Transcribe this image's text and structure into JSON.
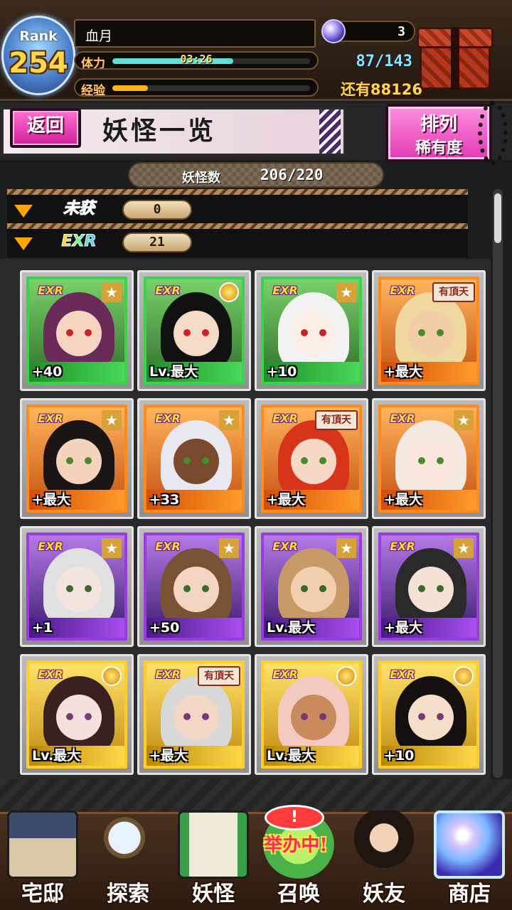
{
  "player": {
    "rank_label": "Rank",
    "rank_value": "254",
    "name": "血月",
    "stamina_label": "体力",
    "stamina_timer": "03:26",
    "stamina_fill": 0.61,
    "stamina_text": "87/143",
    "exp_label": "经验",
    "exp_fill": 0.18,
    "next_text": "还有88126",
    "gems": "3"
  },
  "header": {
    "back_label": "返回",
    "title": "妖怪一览",
    "sort_line1": "排列",
    "sort_line2": "稀有度"
  },
  "count": {
    "label": "妖怪数",
    "value": "206/220"
  },
  "filters": [
    {
      "tag": "未获",
      "value": "0"
    },
    {
      "tag": "EXR",
      "value": "21"
    }
  ],
  "cards": [
    {
      "frame": "green",
      "badge": "EXR",
      "corner": "star",
      "level": "+40"
    },
    {
      "frame": "green",
      "badge": "EXR",
      "corner": "medal",
      "level": "Lv.最大"
    },
    {
      "frame": "green",
      "badge": "EXR",
      "corner": "star",
      "level": "+10"
    },
    {
      "frame": "orange",
      "badge": "EXR",
      "corner": "top",
      "level": "+最大"
    },
    {
      "frame": "orange",
      "badge": "EXR",
      "corner": "star",
      "level": "+最大"
    },
    {
      "frame": "orange",
      "badge": "EXR",
      "corner": "star",
      "level": "+33"
    },
    {
      "frame": "orange",
      "badge": "EXR",
      "corner": "top",
      "level": "+最大"
    },
    {
      "frame": "orange",
      "badge": "EXR",
      "corner": "star",
      "level": "+最大"
    },
    {
      "frame": "purple",
      "badge": "EXR",
      "corner": "star",
      "level": "+1"
    },
    {
      "frame": "purple",
      "badge": "EXR",
      "corner": "star",
      "level": "+50"
    },
    {
      "frame": "purple",
      "badge": "EXR",
      "corner": "star",
      "level": "Lv.最大"
    },
    {
      "frame": "purple",
      "badge": "EXR",
      "corner": "star",
      "level": "+最大"
    },
    {
      "frame": "gold",
      "badge": "EXR",
      "corner": "medal",
      "level": "Lv.最大"
    },
    {
      "frame": "gold",
      "badge": "EXR",
      "corner": "top",
      "level": "+最大"
    },
    {
      "frame": "gold",
      "badge": "EXR",
      "corner": "medal",
      "level": "Lv.最大"
    },
    {
      "frame": "gold",
      "badge": "EXR",
      "corner": "medal",
      "level": "+10"
    }
  ],
  "corner_top_label": "有頂天",
  "nav": [
    {
      "label": "宅邸",
      "icon": "house-icon"
    },
    {
      "label": "探索",
      "icon": "magnifier-icon"
    },
    {
      "label": "妖怪",
      "icon": "scroll-icon"
    },
    {
      "label": "召唤",
      "icon": "summon-icon"
    },
    {
      "label": "妖友",
      "icon": "friend-icon"
    },
    {
      "label": "商店",
      "icon": "crystal-orb-icon"
    }
  ],
  "summon_badge": "!",
  "summon_event": "举办中!",
  "colors": {
    "stamina": "#5fe0d2",
    "exp": "#ffb21a",
    "accent_pink": "#e03ab0"
  }
}
